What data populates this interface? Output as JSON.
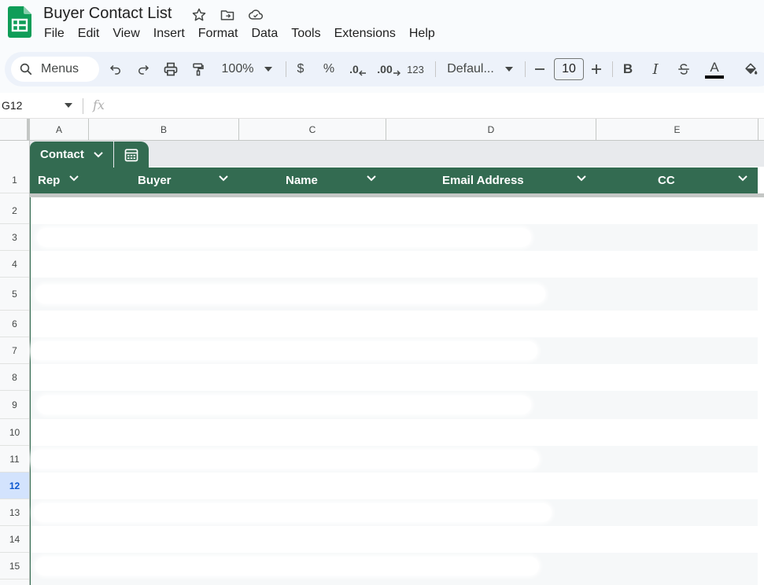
{
  "app": {
    "title": "Buyer Contact List",
    "brand_color": "#0f9d58",
    "table_color": "#336b51"
  },
  "menu": [
    "File",
    "Edit",
    "View",
    "Insert",
    "Format",
    "Data",
    "Tools",
    "Extensions",
    "Help"
  ],
  "toolbar": {
    "search_label": "Menus",
    "zoom": "100%",
    "currency": "$",
    "percent": "%",
    "decrease_decimal": ".0",
    "increase_decimal": ".00",
    "number_format": "123",
    "font": "Defaul...",
    "font_size": "10",
    "bold": "B",
    "italic": "I",
    "text_color": "A"
  },
  "formula_bar": {
    "cell_ref": "G12",
    "fx": "fx"
  },
  "columns": [
    "A",
    "B",
    "C",
    "D",
    "E"
  ],
  "rows": [
    "1",
    "2",
    "3",
    "4",
    "5",
    "6",
    "7",
    "8",
    "9",
    "10",
    "11",
    "12",
    "13",
    "14",
    "15"
  ],
  "active_row": "12",
  "table": {
    "name": "Contact",
    "headers": [
      "Rep",
      "Buyer",
      "Name",
      "Email Address",
      "CC"
    ]
  }
}
